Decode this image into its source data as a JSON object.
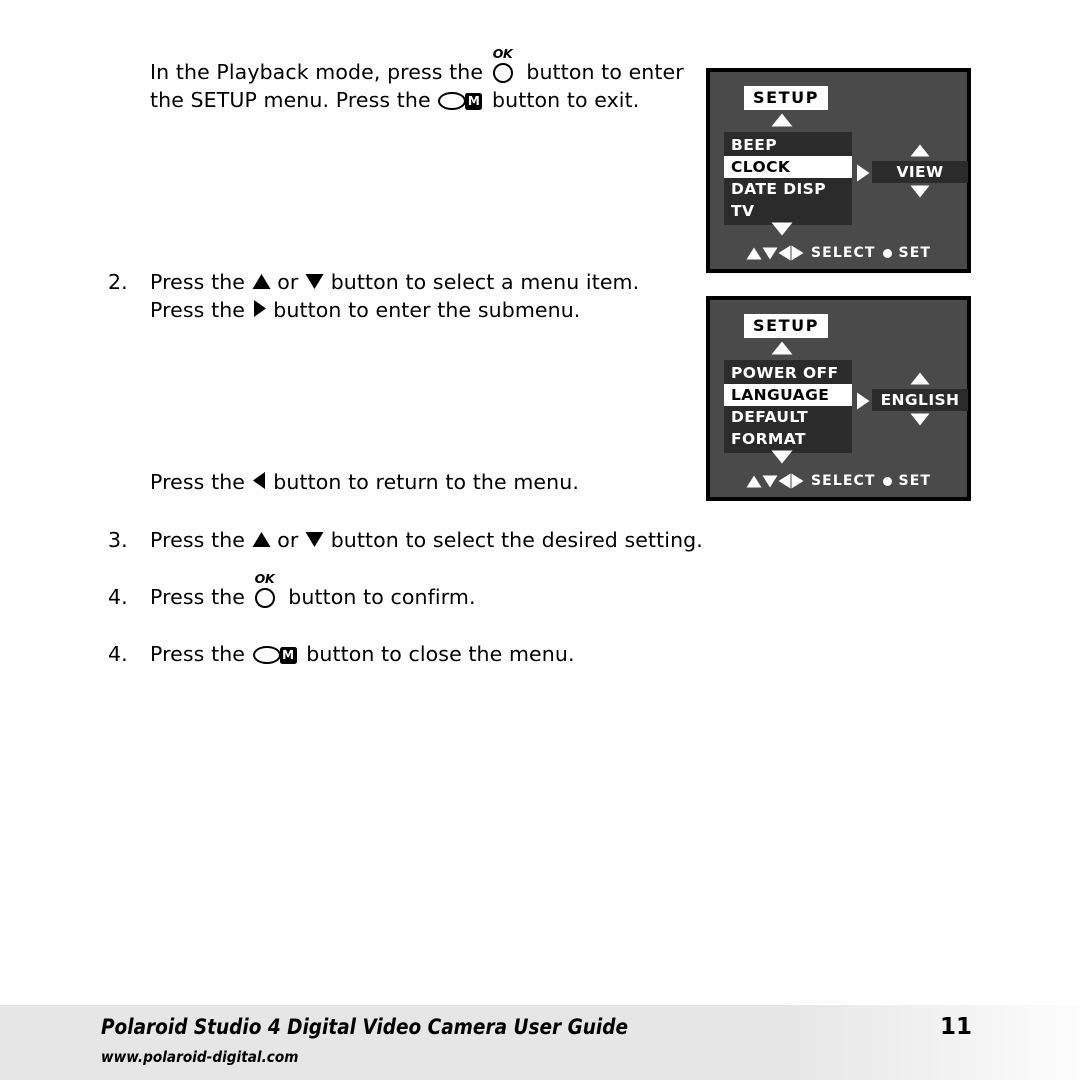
{
  "document": {
    "type": "user-guide-page",
    "page_number": "11"
  },
  "steps": {
    "intro": {
      "number": "",
      "text_part_1": "In the Playback mode, press the",
      "btn_ok": "OK",
      "text_part_2": "button to enter the SETUP menu. Press the",
      "btn_menu": "M",
      "text_part_3": "button to exit."
    },
    "step2": {
      "number": "2.",
      "text_part_1": "Press the",
      "text_part_2": "or",
      "text_part_3": "button to select a menu item. Press the",
      "text_part_4": "button to enter the submenu."
    },
    "back": {
      "number": "",
      "text_part_1": "Press the",
      "text_part_2": "button to return to the menu."
    },
    "step3": {
      "number": "3.",
      "text_part_1": "Press the",
      "text_part_2": "or",
      "text_part_3": "button to select the desired setting."
    },
    "step4a": {
      "number": "4.",
      "text_part_1": "Press the",
      "btn_ok": "OK",
      "text_part_2": "button to confirm."
    },
    "step4b": {
      "number": "4.",
      "text_part_1": "Press the",
      "btn_menu": "M",
      "text_part_2": "button to close the menu."
    }
  },
  "lcd_screens": [
    {
      "title": "SETUP",
      "menu_items": [
        {
          "label": "BEEP",
          "selected": false
        },
        {
          "label": "CLOCK",
          "selected": true
        },
        {
          "label": "DATE DISP",
          "selected": false
        },
        {
          "label": "TV",
          "selected": false
        }
      ],
      "submenu_value": "VIEW",
      "bottom_bar": {
        "select_label": "SELECT",
        "set_label": "SET"
      }
    },
    {
      "title": "SETUP",
      "menu_items": [
        {
          "label": "POWER OFF",
          "selected": false
        },
        {
          "label": "LANGUAGE",
          "selected": true
        },
        {
          "label": "DEFAULT",
          "selected": false
        },
        {
          "label": "FORMAT",
          "selected": false
        }
      ],
      "submenu_value": "ENGLISH",
      "bottom_bar": {
        "select_label": "SELECT",
        "set_label": "SET"
      }
    }
  ],
  "footer": {
    "title": "Polaroid Studio 4 Digital Video Camera User Guide",
    "url": "www.polaroid-digital.com",
    "page_number": "11"
  },
  "colors": {
    "lcd_body": "#4a4a4a",
    "lcd_panel": "#2b2b2b",
    "lcd_selected": "#ffffff",
    "lcd_border": "#000000",
    "footer_band": "#e6e6e6",
    "text": "#000000"
  }
}
